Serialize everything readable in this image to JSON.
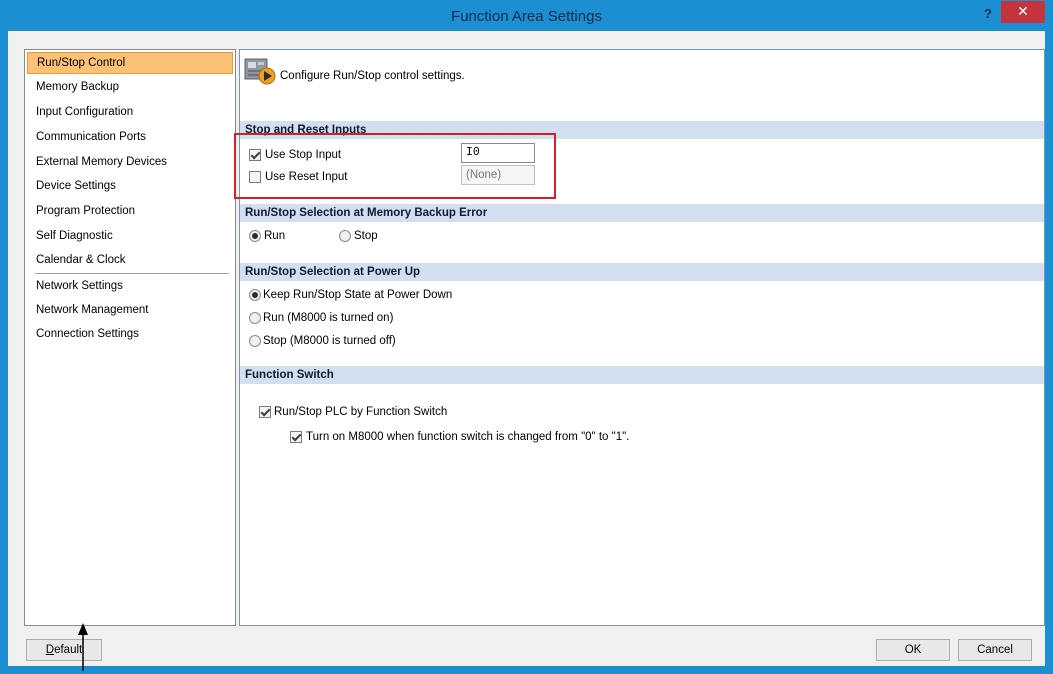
{
  "window": {
    "title": "Function Area Settings",
    "help_label": "?",
    "close_label": "✕"
  },
  "nav": {
    "items": [
      {
        "label": "Run/Stop Control",
        "selected": true
      },
      {
        "label": "Memory Backup"
      },
      {
        "label": "Input Configuration"
      },
      {
        "label": "Communication Ports"
      },
      {
        "label": "External Memory Devices"
      },
      {
        "label": "Device Settings"
      },
      {
        "label": "Program Protection"
      },
      {
        "label": "Self Diagnostic"
      },
      {
        "label": "Calendar & Clock"
      },
      {
        "label": "Network Settings"
      },
      {
        "label": "Network Management"
      },
      {
        "label": "Connection Settings"
      }
    ]
  },
  "panel": {
    "header_text": "Configure Run/Stop control settings.",
    "stop_reset": {
      "title": "Stop and Reset Inputs",
      "use_stop_label": "Use Stop Input",
      "use_stop_checked": true,
      "stop_value": "I0",
      "use_reset_label": "Use Reset Input",
      "use_reset_checked": false,
      "reset_value": "(None)"
    },
    "backup_error": {
      "title": "Run/Stop Selection at Memory Backup Error",
      "run_label": "Run",
      "stop_label": "Stop",
      "selected": "Run"
    },
    "power_up": {
      "title": "Run/Stop Selection at Power Up",
      "options": [
        "Keep Run/Stop State at Power Down",
        "Run (M8000 is turned on)",
        "Stop (M8000 is turned off)"
      ],
      "selected": "Keep Run/Stop State at Power Down"
    },
    "function_switch": {
      "title": "Function Switch",
      "run_stop_label": "Run/Stop PLC by Function Switch",
      "run_stop_checked": true,
      "turn_on_label": "Turn on M8000 when function switch is changed from \"0\" to \"1\".",
      "turn_on_checked": true
    }
  },
  "footer": {
    "default_label": "Default",
    "default_mnemonic": "D",
    "default_rest": "efault",
    "ok_label": "OK",
    "cancel_label": "Cancel"
  },
  "colors": {
    "title_bar": "#1c8fd3",
    "close_button": "#c6343b",
    "selected_nav": "#fbc276",
    "section_header": "#d2dfef",
    "highlight": "#d0202a"
  }
}
